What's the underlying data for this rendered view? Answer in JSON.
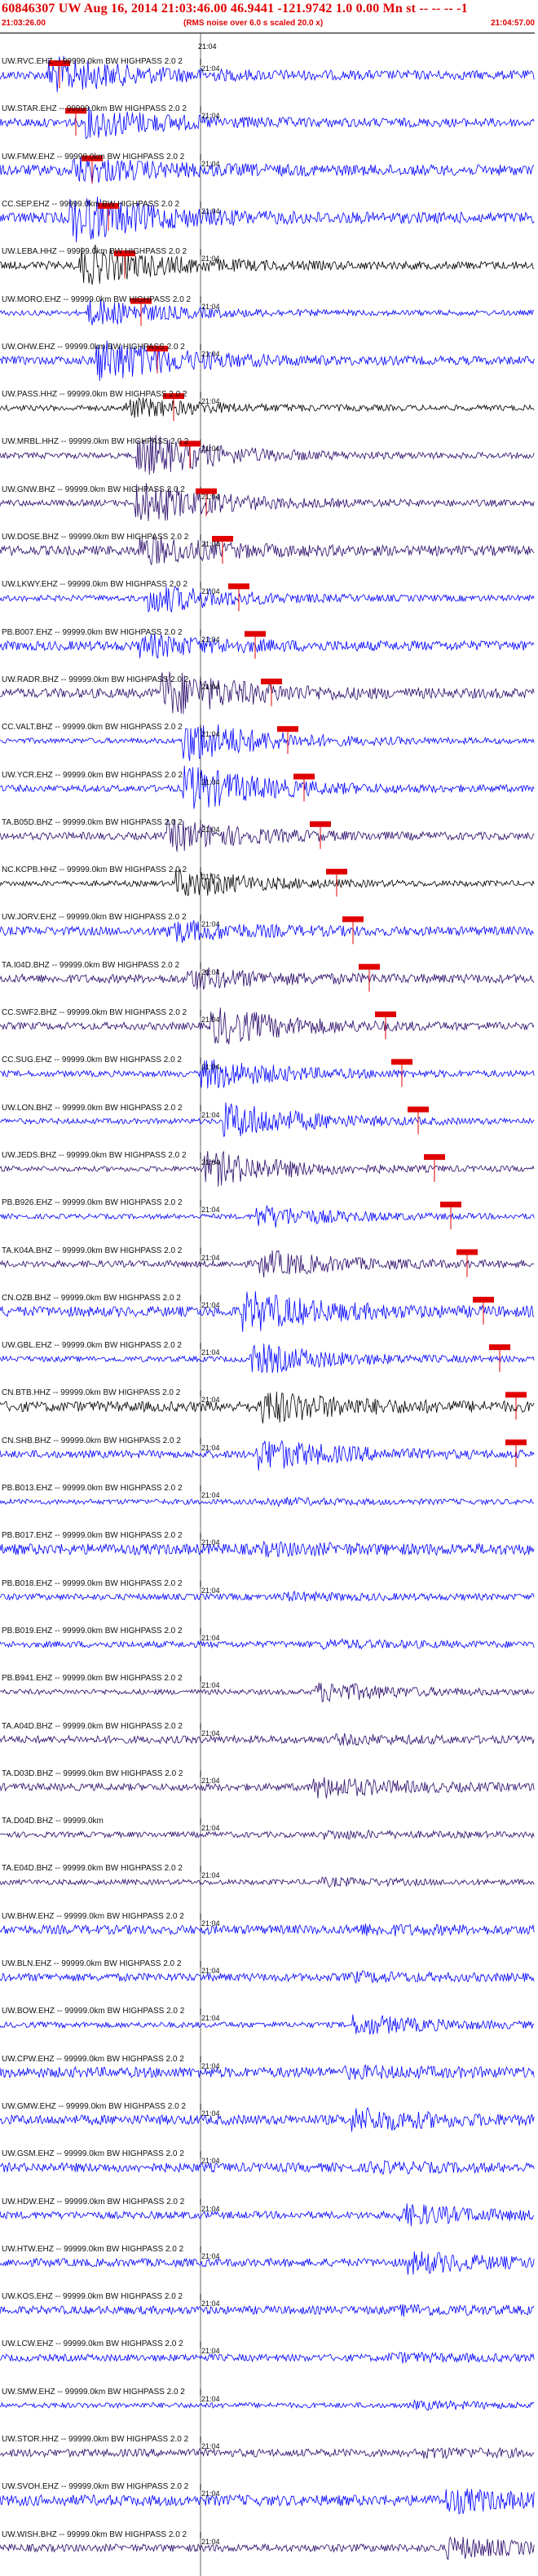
{
  "header": {
    "title": "60846307 UW Aug 16, 2014 21:03:46.00   46.9441 -121.9742   1.0 0.00 Mn st -- -- -- -1",
    "start_time": "21:03:26.00",
    "note": "(RMS noise over 6.0 s scaled 20.0 x)",
    "end_time": "21:04:57.00"
  },
  "minute_tick_label": "21:04",
  "colors": {
    "trace_blue": "#0000ff",
    "trace_dark": "#2a0a6a",
    "trace_black": "#000000",
    "pick_red": "#e00000",
    "header_red": "#e00000"
  },
  "channels": [
    {
      "label": "UW.RVC.EHZ -- 99999.0km BW  HIGHPASS  2.0  2",
      "color": "blue"
    },
    {
      "label": "UW.STAR.EHZ -- 99999.0km BW  HIGHPASS  2.0  2",
      "color": "blue"
    },
    {
      "label": "UW.FMW.EHZ -- 99999.0km BW  HIGHPASS  2.0  2",
      "color": "blue"
    },
    {
      "label": "CC.SEP.EHZ -- 99999.0km BW  HIGHPASS  2.0  2",
      "color": "blue"
    },
    {
      "label": "UW.LEBA.HHZ -- 99999.0km BW  HIGHPASS  2.0  2",
      "color": "black"
    },
    {
      "label": "UW.MORO.EHZ -- 99999.0km BW  HIGHPASS  2.0  2",
      "color": "blue"
    },
    {
      "label": "UW.OHW.EHZ -- 99999.0km BW  HIGHPASS  2.0  2",
      "color": "blue"
    },
    {
      "label": "UW.PASS.HHZ -- 99999.0km BW  HIGHPASS  2.0  2",
      "color": "black"
    },
    {
      "label": "UW.MRBL.HHZ -- 99999.0km BW  HIGHPASS  2.0  2",
      "color": "dark"
    },
    {
      "label": "UW.GNW.BHZ -- 99999.0km BW  HIGHPASS  2.0  2",
      "color": "dark"
    },
    {
      "label": "UW.DOSE.BHZ -- 99999.0km BW  HIGHPASS  2.0  2",
      "color": "dark"
    },
    {
      "label": "UW.LKWY.EHZ -- 99999.0km BW  HIGHPASS  2.0  2",
      "color": "blue"
    },
    {
      "label": "PB.B007.EHZ -- 99999.0km BW  HIGHPASS  2.0  2",
      "color": "blue"
    },
    {
      "label": "UW.RADR.BHZ -- 99999.0km BW  HIGHPASS  2.0  2",
      "color": "dark"
    },
    {
      "label": "CC.VALT.BHZ -- 99999.0km BW  HIGHPASS  2.0  2",
      "color": "blue"
    },
    {
      "label": "UW.YCR.EHZ -- 99999.0km BW  HIGHPASS  2.0  2",
      "color": "blue"
    },
    {
      "label": "TA.B05D.BHZ -- 99999.0km BW  HIGHPASS  2.0  2",
      "color": "dark"
    },
    {
      "label": "NC.KCPB.HHZ -- 99999.0km BW  HIGHPASS  2.0  2",
      "color": "black"
    },
    {
      "label": "UW.JORV.EHZ -- 99999.0km BW  HIGHPASS  2.0  2",
      "color": "blue"
    },
    {
      "label": "TA.I04D.BHZ -- 99999.0km BW  HIGHPASS  2.0  2",
      "color": "dark"
    },
    {
      "label": "CC.SWF2.BHZ -- 99999.0km BW  HIGHPASS  2.0  2",
      "color": "dark"
    },
    {
      "label": "CC.SUG.EHZ -- 99999.0km BW  HIGHPASS  2.0  2",
      "color": "blue"
    },
    {
      "label": "UW.LON.BHZ -- 99999.0km BW  HIGHPASS  2.0  2",
      "color": "blue"
    },
    {
      "label": "UW.JEDS.BHZ -- 99999.0km BW  HIGHPASS  2.0  2",
      "color": "dark"
    },
    {
      "label": "PB.B926.EHZ -- 99999.0km BW  HIGHPASS  2.0  2",
      "color": "blue"
    },
    {
      "label": "TA.K04A.BHZ -- 99999.0km BW  HIGHPASS  2.0  2",
      "color": "dark"
    },
    {
      "label": "CN.OZB.BHZ -- 99999.0km BW  HIGHPASS  2.0  2",
      "color": "blue"
    },
    {
      "label": "UW.GBL.EHZ -- 99999.0km BW  HIGHPASS  2.0  2",
      "color": "blue"
    },
    {
      "label": "CN.BTB.HHZ -- 99999.0km BW  HIGHPASS  2.0  2",
      "color": "black"
    },
    {
      "label": "CN.SHB.BHZ -- 99999.0km BW  HIGHPASS  2.0  2",
      "color": "blue"
    },
    {
      "label": "PB.B013.EHZ -- 99999.0km BW  HIGHPASS  2.0  2",
      "color": "blue"
    },
    {
      "label": "PB.B017.EHZ -- 99999.0km BW  HIGHPASS  2.0  2",
      "color": "blue"
    },
    {
      "label": "PB.B018.EHZ -- 99999.0km BW  HIGHPASS  2.0  2",
      "color": "blue"
    },
    {
      "label": "PB.B019.EHZ -- 99999.0km BW  HIGHPASS  2.0  2",
      "color": "blue"
    },
    {
      "label": "PB.B941.EHZ -- 99999.0km BW  HIGHPASS  2.0  2",
      "color": "dark"
    },
    {
      "label": "TA.A04D.BHZ -- 99999.0km BW  HIGHPASS  2.0  2",
      "color": "dark"
    },
    {
      "label": "TA.D03D.BHZ -- 99999.0km BW  HIGHPASS  2.0  2",
      "color": "dark"
    },
    {
      "label": "TA.D04D.BHZ -- 99999.0km",
      "color": "dark"
    },
    {
      "label": "TA.E04D.BHZ -- 99999.0km BW  HIGHPASS  2.0  2",
      "color": "dark"
    },
    {
      "label": "UW.BHW.EHZ -- 99999.0km BW  HIGHPASS  2.0  2",
      "color": "blue"
    },
    {
      "label": "UW.BLN.EHZ -- 99999.0km BW  HIGHPASS  2.0  2",
      "color": "blue"
    },
    {
      "label": "UW.BOW.EHZ -- 99999.0km BW  HIGHPASS  2.0  2",
      "color": "blue"
    },
    {
      "label": "UW.CPW.EHZ -- 99999.0km BW  HIGHPASS  2.0  2",
      "color": "blue"
    },
    {
      "label": "UW.GMW.EHZ -- 99999.0km BW  HIGHPASS  2.0  2",
      "color": "blue"
    },
    {
      "label": "UW.GSM.EHZ -- 99999.0km BW  HIGHPASS  2.0  2",
      "color": "blue"
    },
    {
      "label": "UW.HDW.EHZ -- 99999.0km BW  HIGHPASS  2.0  2",
      "color": "blue"
    },
    {
      "label": "UW.HTW.EHZ -- 99999.0km BW  HIGHPASS  2.0  2",
      "color": "blue"
    },
    {
      "label": "UW.KOS.EHZ -- 99999.0km BW  HIGHPASS  2.0  2",
      "color": "blue"
    },
    {
      "label": "UW.LCW.EHZ -- 99999.0km BW  HIGHPASS  2.0  2",
      "color": "blue"
    },
    {
      "label": "UW.SMW.EHZ -- 99999.0km BW  HIGHPASS  2.0  2",
      "color": "blue"
    },
    {
      "label": "UW.STOR.HHZ -- 99999.0km BW  HIGHPASS  2.0  2",
      "color": "dark"
    },
    {
      "label": "UW.SVOH.EHZ -- 99999.0km BW  HIGHPASS  2.0  2",
      "color": "blue"
    },
    {
      "label": "UW.WISH.BHZ -- 99999.0km BW  HIGHPASS  2.0  2",
      "color": "dark"
    }
  ]
}
